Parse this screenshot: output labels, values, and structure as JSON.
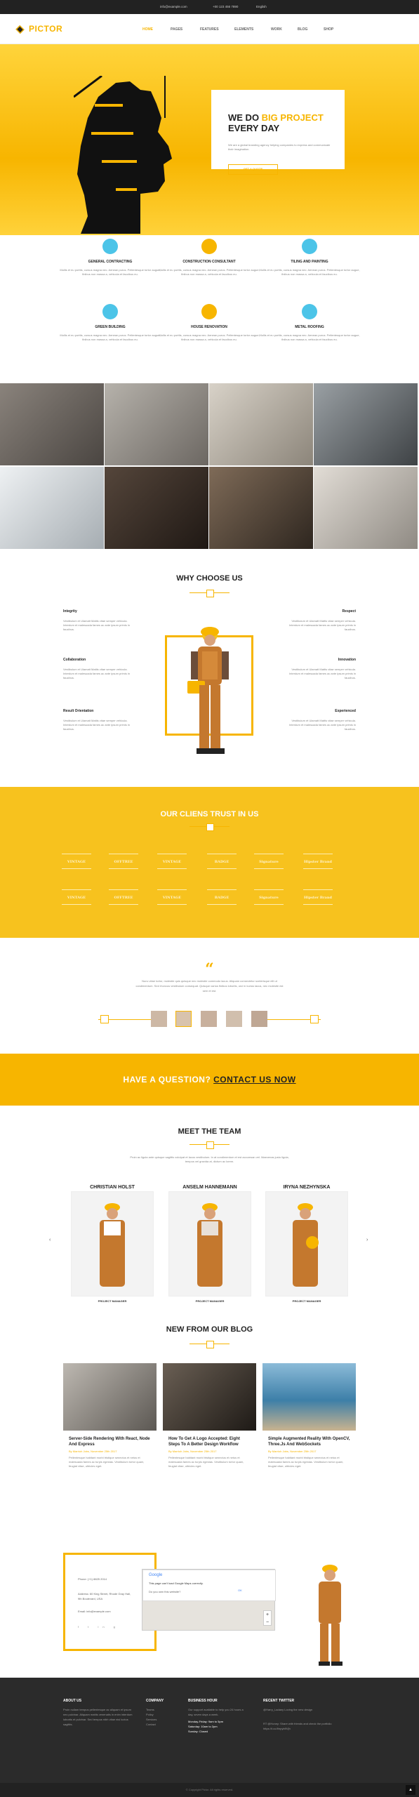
{
  "topbar": {
    "email": "info@example.com",
    "phone": "+00 123 456 7890",
    "language": "English"
  },
  "header": {
    "brand": "PICTOR",
    "nav": [
      "HOME",
      "PAGES",
      "FEATURES",
      "ELEMENTS",
      "WORK",
      "BLOG",
      "SHOP"
    ]
  },
  "hero": {
    "title_pre": "WE DO ",
    "title_accent": "BIG PROJECT",
    "title_line2": "EVERY DAY",
    "text": "We are a global branding agency helping companies to express and communicate their imagination.",
    "button": "GET A QUOTE"
  },
  "services": [
    {
      "title": "GENERAL CONTRACTING",
      "desc": "Mollis et eu porttis, cursus magna nec. Aenean purus. Pellentesque tortor augue, finibus non massa a, vehicula et faucibus eu.",
      "color": "#4cc4e8",
      "icon": "leaf-icon"
    },
    {
      "title": "CONSTRUCTION CONSULTANT",
      "desc": "Mollis et eu porttis, cursus magna nec. Aenean purus. Pellentesque tortor augue, finibus non massa a, vehicula et faucibus eu.",
      "color": "#f7b500",
      "icon": "hammer-icon"
    },
    {
      "title": "TILING AND PAINTING",
      "desc": "Mollis et eu porttis, cursus magna nec. Aenean purus. Pellentesque tortor augue, finibus non massa a, vehicula et faucibus eu.",
      "color": "#4cc4e8",
      "icon": "paint-roller-icon"
    },
    {
      "title": "GREEN BUILDING",
      "desc": "Mollis et eu porttis, cursus magna nec. Aenean purus. Pellentesque tortor augue, finibus non massa a, vehicula et faucibus eu.",
      "color": "#4cc4e8",
      "icon": "trowel-icon"
    },
    {
      "title": "HOUSE RENOVATION",
      "desc": "Mollis et eu porttis, cursus magna nec. Aenean purus. Pellentesque tortor augue, finibus non massa a, vehicula et faucibus eu.",
      "color": "#f7b500",
      "icon": "gear-icon"
    },
    {
      "title": "METAL ROOFING",
      "desc": "Mollis et eu porttis, cursus magna nec. Aenean purus. Pellentesque tortor augue, finibus non massa a, vehicula et faucibus eu.",
      "color": "#4cc4e8",
      "icon": "drill-icon"
    }
  ],
  "gallery": [
    {
      "color": "#6b6560"
    },
    {
      "color": "#8a8682"
    },
    {
      "color": "#b3aca1"
    },
    {
      "color": "#5a5f63"
    },
    {
      "color": "#cfd4d8"
    },
    {
      "color": "#3a2f29"
    },
    {
      "color": "#594a3c"
    },
    {
      "color": "#b9b4ae"
    }
  ],
  "why": {
    "title": "WHY CHOOSE US",
    "left": [
      {
        "title": "Integrity",
        "desc": "Vestibulum et Ulamatt Mattis vitae semper vehicula. Interdum et malesuada fames ac ante ipsum primis in faucibus."
      },
      {
        "title": "Collaboration",
        "desc": "Vestibulum et Ulamatt Mattis vitae semper vehicula. Interdum et malesuada fames ac ante ipsum primis in faucibus."
      },
      {
        "title": "Result Orientation",
        "desc": "Vestibulum et Ulamatt Mattis vitae semper vehicula. Interdum et malesuada fames ac ante ipsum primis in faucibus."
      }
    ],
    "right": [
      {
        "title": "Respect",
        "desc": "Vestibulum et Ulamatt Mattis vitae semper vehicula. Interdum et malesuada fames ac ante ipsum primis in faucibus."
      },
      {
        "title": "Innovation",
        "desc": "Vestibulum et Ulamatt Mattis vitae semper vehicula. Interdum et malesuada fames ac ante ipsum primis in faucibus."
      },
      {
        "title": "Experienced",
        "desc": "Vestibulum et Ulamatt Mattis vitae semper vehicula. Interdum et malesuada fames ac ante ipsum primis in faucibus."
      }
    ]
  },
  "clients": {
    "title": "OUR CLIENS TRUST IN US",
    "logos": [
      "VINTAGE",
      "OFFTREE",
      "VINTAGE",
      "BADGE",
      "Signature",
      "Hipster Brand",
      "VINTAGE",
      "OFFTREE",
      "VINTAGE",
      "BADGE",
      "Signature",
      "Hipster Brand"
    ]
  },
  "testimonial": {
    "quote_mark": "“",
    "text": "Nunc vitae tortor, molestie quis quisque nec molestie commodo lacus. Aliquam consectetur scelerisque elit ut condimentum. Sed rhoncus vestibulum consequat. Quisque varius finibus lobortis, orci in luctus lacus, nec molestie est sem et est."
  },
  "cta": {
    "pre": "HAVE A QUESTION? ",
    "link": "CONTACT US NOW"
  },
  "team": {
    "title": "MEET THE TEAM",
    "intro": "Proin ac ligula ante quisque sagittis volutpat et lacus vestibulum. In at condimentum et est accumsan vel. Maecenas justo ligula, tempus vel gravida at, dictum ac lorem.",
    "members": [
      {
        "name": "CHRISTIAN HOLST",
        "role": "PROJECT MANAGER"
      },
      {
        "name": "ANSELM HANNEMANN",
        "role": "PROJECT MANAGER"
      },
      {
        "name": "IRYNA NEZHYNSKA",
        "role": "PROJECT MANAGER"
      }
    ],
    "prev": "‹",
    "next": "›"
  },
  "blog": {
    "title": "NEW FROM OUR BLOG",
    "posts": [
      {
        "title": "Server-Side Rendering With React, Node And Express",
        "meta": "By Marrioh Jobs, November 25th 2017",
        "desc": "Pellentesque habitant morbi tristique senectus et netus et malesuada fames ac turpis egestas. Vestibulum tortor quam, feugiat vitae, ultricies eget.",
        "color": "#7a7772"
      },
      {
        "title": "How To Get A Logo Accepted: Eight Steps To A Better Design Workflow",
        "meta": "By Marrioh Jobs, November 25th 2017",
        "desc": "Pellentesque habitant morbi tristique senectus et netus et malesuada fames ac turpis egestas. Vestibulum tortor quam, feugiat vitae, ultricies eget.",
        "color": "#3b3630"
      },
      {
        "title": "Simple Augmented Reality With OpenCV, Three.Js And WebSockets",
        "meta": "By Marrioh Jobs, November 25th 2017",
        "desc": "Pellentesque habitant morbi tristique senectus et netus et malesuada fames ac turpis egestas. Vestibulum tortor quam, feugiat vitae, ultricies eget.",
        "color": "#3d7fa8"
      }
    ]
  },
  "contact": {
    "phone": "Phone: (+1) 8825 2014",
    "address": "Address: 60 King Street, Rhode Gray Hall, 9th Boulevard, USA",
    "email": "Email: info@example.com",
    "map_brand": "Google",
    "map_msg": "This page can't load Google Maps correctly.",
    "map_q": "Do you own this website?",
    "map_ok": "OK"
  },
  "footer": {
    "about_h": "ABOUT US",
    "about_t": "Proin nullam tempus pellentesque ac aliquam et ipsum nec pulvinar. Aliquam mattis venenatis in enim interdum lobortis et pulvinar. Sed tempus nibh vitae nisi luctus sagittis.",
    "company_h": "COMPANY",
    "company": [
      "Teams",
      "Policy",
      "Services",
      "Contact"
    ],
    "hours_h": "BUSINESS HOUR",
    "hours_t": "Our support available to help you 24 hours a day, seven days a week.",
    "hours": [
      "Monday-Friday: 9am to 5pm",
      "Saturday: 10am to 2pm",
      "Sunday: Closed"
    ],
    "twitter_h": "RECENT TWITTER",
    "tweets": [
      "@Harry_Ladany Loving the new design",
      "RT @Honey: Share with friends and check the portfolio https://t.co/Ihrpyb9Vjh"
    ],
    "copyright": "© Copyright Pictor. All rights reserved."
  }
}
